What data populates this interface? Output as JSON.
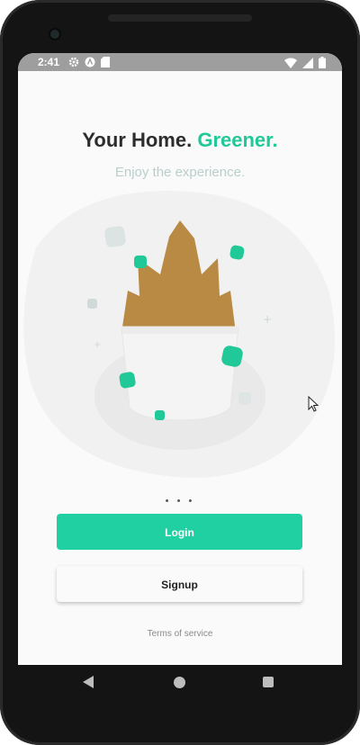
{
  "status_bar": {
    "time": "2:41",
    "left_icons": [
      "gear-icon",
      "app-notification-icon",
      "sd-card-icon"
    ],
    "right_icons": [
      "wifi-icon",
      "signal-icon",
      "battery-icon"
    ]
  },
  "header": {
    "title_part1": "Your Home.",
    "title_part2": "Greener.",
    "subtitle": "Enjoy the experience."
  },
  "pager": {
    "indicator": "• • •"
  },
  "buttons": {
    "login_label": "Login",
    "signup_label": "Signup"
  },
  "footer": {
    "terms_label": "Terms of service"
  },
  "colors": {
    "accent": "#20c997",
    "login_button": "#20cfa2",
    "plant_leaves": "#b98a43",
    "pot": "#f2f2f2",
    "background": "#fafafa"
  },
  "system_nav": {
    "icons": [
      "back-icon",
      "home-icon",
      "recents-icon"
    ]
  }
}
